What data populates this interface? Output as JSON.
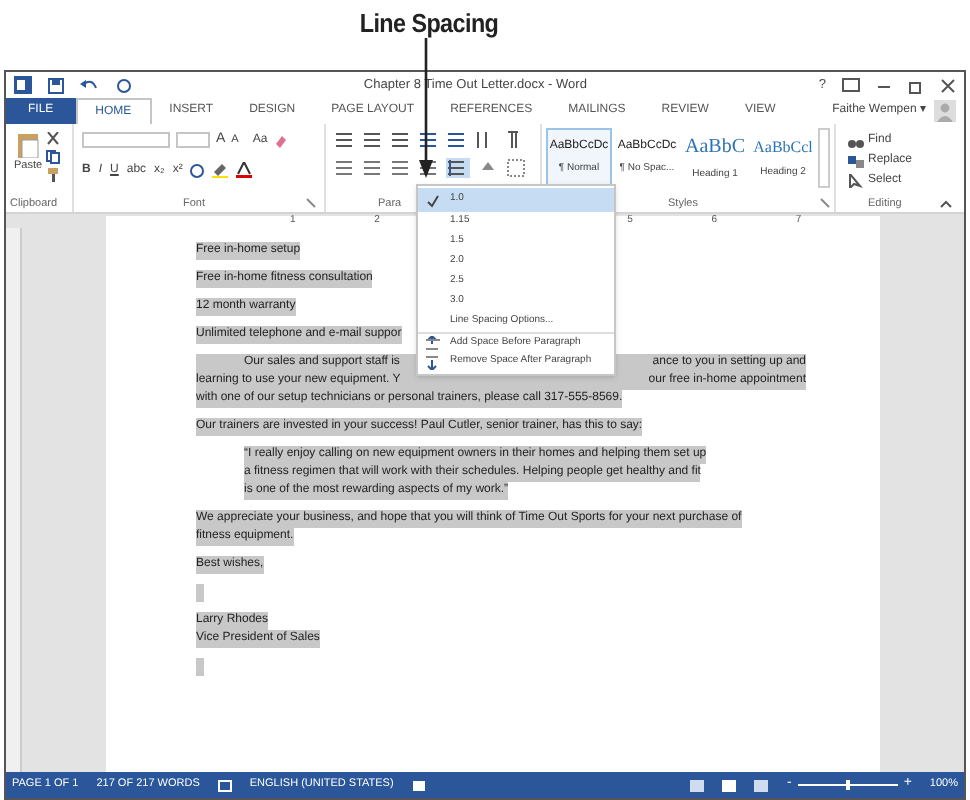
{
  "callout": {
    "label": "Line Spacing"
  },
  "window": {
    "title": "Chapter 8 Time Out Letter.docx - Word",
    "help": "?"
  },
  "tabs": [
    {
      "label": "FILE",
      "kind": "file",
      "selected": false
    },
    {
      "label": "HOME",
      "kind": "tab",
      "selected": true
    },
    {
      "label": "INSERT",
      "kind": "tab",
      "selected": false
    },
    {
      "label": "DESIGN",
      "kind": "tab",
      "selected": false
    },
    {
      "label": "PAGE LAYOUT",
      "kind": "tab",
      "selected": false
    },
    {
      "label": "REFERENCES",
      "kind": "tab",
      "selected": false
    },
    {
      "label": "MAILINGS",
      "kind": "tab",
      "selected": false
    },
    {
      "label": "REVIEW",
      "kind": "tab",
      "selected": false
    },
    {
      "label": "VIEW",
      "kind": "tab",
      "selected": false
    }
  ],
  "user": {
    "name": "Faithe Wempen",
    "menu_glyph": "▾"
  },
  "ribbon": {
    "clipboard": {
      "paste": "Paste",
      "label": "Clipboard"
    },
    "font": {
      "label": "Font",
      "grow": "A",
      "shrink": "A",
      "case": "Aa",
      "buttons": [
        "B",
        "I",
        "U",
        "abc",
        "x₂",
        "x²"
      ]
    },
    "paragraph": {
      "label": "Para"
    },
    "styles": {
      "label": "Styles",
      "items": [
        {
          "preview": "AaBbCcDc",
          "name": "¶ Normal",
          "kind": "body",
          "selected": true
        },
        {
          "preview": "AaBbCcDc",
          "name": "¶ No Spac...",
          "kind": "body",
          "selected": false
        },
        {
          "preview": "AaBbC",
          "name": "Heading 1",
          "kind": "heading1",
          "selected": false
        },
        {
          "preview": "AaBbCcl",
          "name": "Heading 2",
          "kind": "heading2",
          "selected": false
        }
      ]
    },
    "editing": {
      "label": "Editing",
      "items": [
        {
          "label": "Find",
          "kind": "find"
        },
        {
          "label": "Replace",
          "kind": "replace"
        },
        {
          "label": "Select",
          "kind": "select"
        }
      ]
    }
  },
  "line_spacing_menu": {
    "items": [
      {
        "label": "1.0",
        "kind": "value",
        "selected": true
      },
      {
        "label": "1.15",
        "kind": "value",
        "selected": false
      },
      {
        "label": "1.5",
        "kind": "value",
        "selected": false
      },
      {
        "label": "2.0",
        "kind": "value",
        "selected": false
      },
      {
        "label": "2.5",
        "kind": "value",
        "selected": false
      },
      {
        "label": "3.0",
        "kind": "value",
        "selected": false
      },
      {
        "label": "Line Spacing Options...",
        "kind": "option"
      },
      {
        "label": "Add Space Before Paragraph",
        "kind": "add"
      },
      {
        "label": "Remove Space After Paragraph",
        "kind": "remove"
      }
    ]
  },
  "ruler": {
    "left_labels": [
      "1",
      "2"
    ],
    "right_labels": [
      "5",
      "6",
      "7"
    ]
  },
  "document": {
    "paragraphs": [
      {
        "kind": "plain",
        "lines": [
          {
            "text": "Free in-home setup"
          }
        ]
      },
      {
        "kind": "plain",
        "lines": [
          {
            "text": "Free in-home fitness consultation"
          }
        ]
      },
      {
        "kind": "plain",
        "lines": [
          {
            "text": "12 month warranty"
          }
        ]
      },
      {
        "kind": "plain",
        "lines": [
          {
            "text": "Unlimited telephone and e-mail suppor"
          }
        ]
      },
      {
        "kind": "first_indent",
        "lines": [
          {
            "left": "Our sales and support staff is",
            "right": "ance to you in setting up and"
          },
          {
            "left": "learning to use your new equipment.  Y",
            "right": "our free in-home appointment"
          },
          {
            "text": "with one of our setup technicians or personal trainers, please call 317-555-8569."
          }
        ]
      },
      {
        "kind": "plain",
        "lines": [
          {
            "text": "Our trainers are invested in your success!   Paul Cutler, senior trainer, has this to say:"
          }
        ]
      },
      {
        "kind": "quote",
        "lines": [
          {
            "text": "“I really enjoy calling on new equipment owners in their homes and helping them set up"
          },
          {
            "text": "a fitness regimen that will work with their schedules. Helping people get healthy and fit"
          },
          {
            "text": "is one of the most rewarding aspects of my work.”"
          }
        ]
      },
      {
        "kind": "plain",
        "lines": [
          {
            "text": "We appreciate your business, and hope that you will think of Time Out Sports for your next purchase of"
          },
          {
            "text": "fitness equipment."
          }
        ]
      },
      {
        "kind": "plain",
        "lines": [
          {
            "text": "Best wishes,"
          }
        ]
      },
      {
        "kind": "blank"
      },
      {
        "kind": "plain",
        "lines": [
          {
            "text": "Larry Rhodes"
          },
          {
            "text": "Vice President of Sales"
          }
        ]
      },
      {
        "kind": "blank"
      }
    ]
  },
  "status_bar": {
    "page": "PAGE 1 OF 1",
    "words": "217 OF 217 WORDS",
    "language": "ENGLISH (UNITED STATES)",
    "zoom": {
      "out": "-",
      "in": "+",
      "level": 0.5,
      "reading": "100%"
    }
  }
}
